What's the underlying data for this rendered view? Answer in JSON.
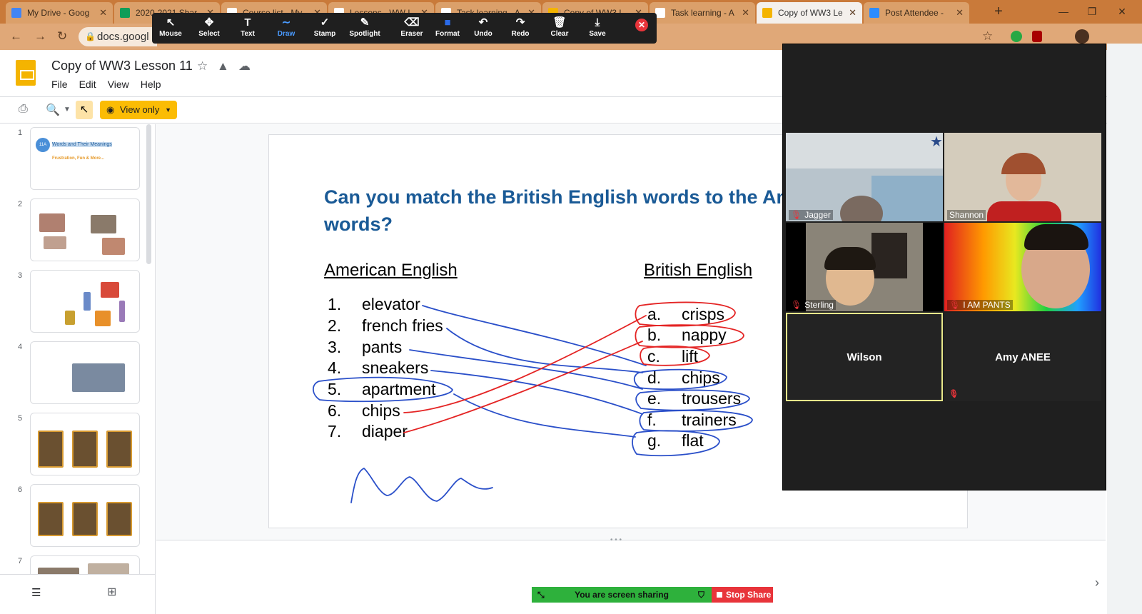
{
  "browser": {
    "tabs": [
      {
        "label": "My Drive - Goog",
        "fav": "#4285f4"
      },
      {
        "label": "2020-2021 Shar",
        "fav": "#0f9d58"
      },
      {
        "label": "Course list - My",
        "fav": "#ffffff"
      },
      {
        "label": "Lessons - WW L",
        "fav": "#ffffff"
      },
      {
        "label": "Task learning - A",
        "fav": "#ffffff"
      },
      {
        "label": "Copy of WW3 L",
        "fav": "#f4b400"
      },
      {
        "label": "Task learning - A",
        "fav": "#ffffff"
      },
      {
        "label": "Copy of WW3 Le",
        "fav": "#f4b400"
      },
      {
        "label": "Post Attendee -",
        "fav": "#2d8cff"
      }
    ],
    "address": "docs.googl"
  },
  "annotate": {
    "tools": [
      {
        "label": "Mouse",
        "icon": "↖"
      },
      {
        "label": "Select",
        "icon": "✥"
      },
      {
        "label": "Text",
        "icon": "T"
      },
      {
        "label": "Draw",
        "icon": "∼"
      },
      {
        "label": "Stamp",
        "icon": "✓"
      },
      {
        "label": "Spotlight",
        "icon": "✎"
      },
      {
        "label": "Eraser",
        "icon": "⌫"
      },
      {
        "label": "Format",
        "icon": "■"
      },
      {
        "label": "Undo",
        "icon": "↶"
      },
      {
        "label": "Redo",
        "icon": "↷"
      },
      {
        "label": "Clear",
        "icon": "🗑"
      },
      {
        "label": "Save",
        "icon": "⤓"
      }
    ],
    "active": "Draw"
  },
  "docs": {
    "title": "Copy of WW3 Lesson 11",
    "menu": [
      "File",
      "Edit",
      "View",
      "Help"
    ],
    "view_only": "View only"
  },
  "filmstrip": {
    "numbers": [
      "1",
      "2",
      "3",
      "4",
      "5",
      "6",
      "7"
    ],
    "slide1_badge": "11A",
    "slide1_title": "Words and Their Meanings",
    "slide1_sub": "Frustration, Fun & More..."
  },
  "slide": {
    "title": "Can you match the British English words to the American English words?",
    "left_head": "American English",
    "right_head": "British English",
    "american": [
      {
        "n": "1.",
        "w": "elevator"
      },
      {
        "n": "2.",
        "w": "french fries"
      },
      {
        "n": "3.",
        "w": "pants"
      },
      {
        "n": "4.",
        "w": "sneakers"
      },
      {
        "n": "5.",
        "w": "apartment"
      },
      {
        "n": "6.",
        "w": "chips"
      },
      {
        "n": "7.",
        "w": "diaper"
      }
    ],
    "british": [
      {
        "n": "a.",
        "w": "crisps"
      },
      {
        "n": "b.",
        "w": "nappy"
      },
      {
        "n": "c.",
        "w": "lift"
      },
      {
        "n": "d.",
        "w": "chips"
      },
      {
        "n": "e.",
        "w": "trousers"
      },
      {
        "n": "f.",
        "w": "trainers"
      },
      {
        "n": "g.",
        "w": "flat"
      }
    ]
  },
  "zoom": {
    "participants": [
      "Jagger",
      "Shannon",
      "Sterling",
      "I AM PANTS"
    ],
    "blank": [
      "Wilson",
      "Amy ANEE"
    ]
  },
  "share": {
    "status": "You are screen sharing",
    "stop": "Stop Share"
  },
  "colors": {
    "title_blue": "#1a5a96",
    "ink_blue": "#2a4fc9",
    "ink_red": "#e42424",
    "zoom_dark": "#1f1f1f",
    "share_green": "#2eb13c"
  }
}
